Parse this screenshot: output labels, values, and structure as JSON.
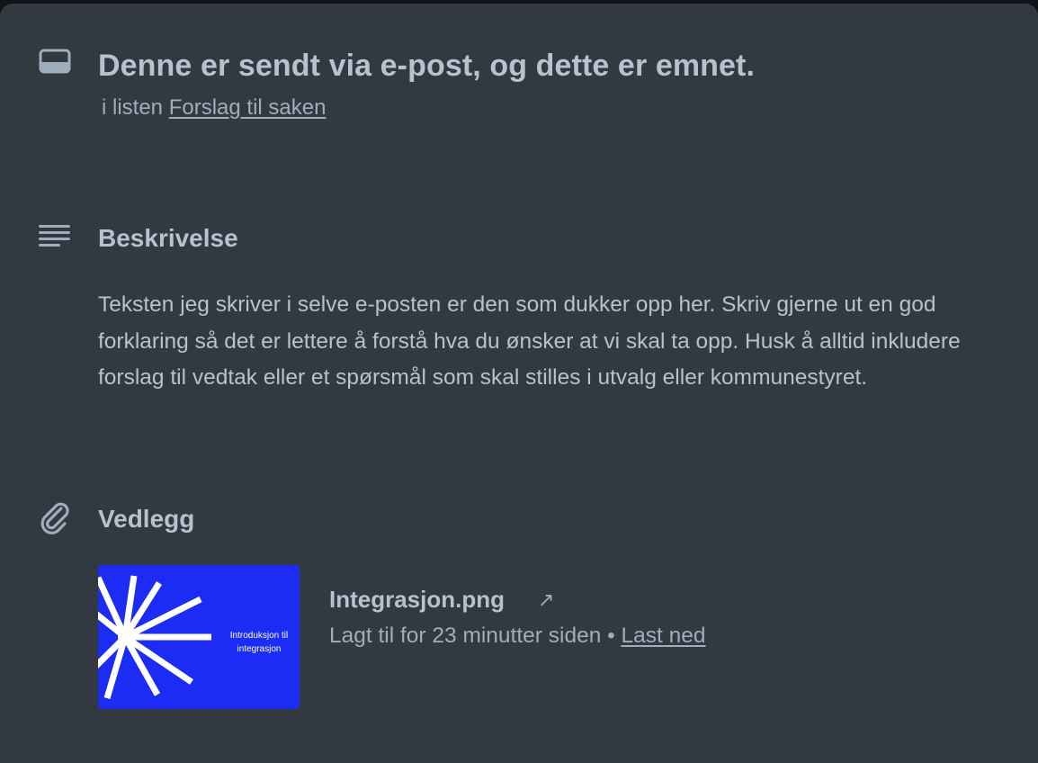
{
  "card": {
    "title": "Denne er sendt via e-post, og dette er emnet.",
    "list_prefix": "i listen",
    "list_name": "Forslag til saken",
    "title_icon": "card-icon"
  },
  "description": {
    "heading": "Beskrivelse",
    "icon": "description-lines-icon",
    "text": "Teksten jeg skriver i selve e-posten er den som dukker opp her. Skriv gjerne ut en god forklaring så det er lettere å forstå hva du ønsker at vi skal ta opp. Husk å alltid inkludere forslag til vedtak eller et spørsmål som skal stilles i utvalg eller kommunestyret."
  },
  "attachments": {
    "heading": "Vedlegg",
    "icon": "paperclip-icon",
    "items": [
      {
        "thumbnail_text": "Introduksjon til integrasjon",
        "file_name": "Integrasjon.png",
        "open_icon": "↗",
        "added_text": "Lagt til for 23 minutter siden",
        "separator": "•",
        "download_label": "Last ned"
      }
    ]
  },
  "colors": {
    "background": "#323940",
    "heading_text": "#b6c2cf",
    "muted_text": "#9fadbc",
    "thumbnail_bg": "#1c2cf5"
  }
}
